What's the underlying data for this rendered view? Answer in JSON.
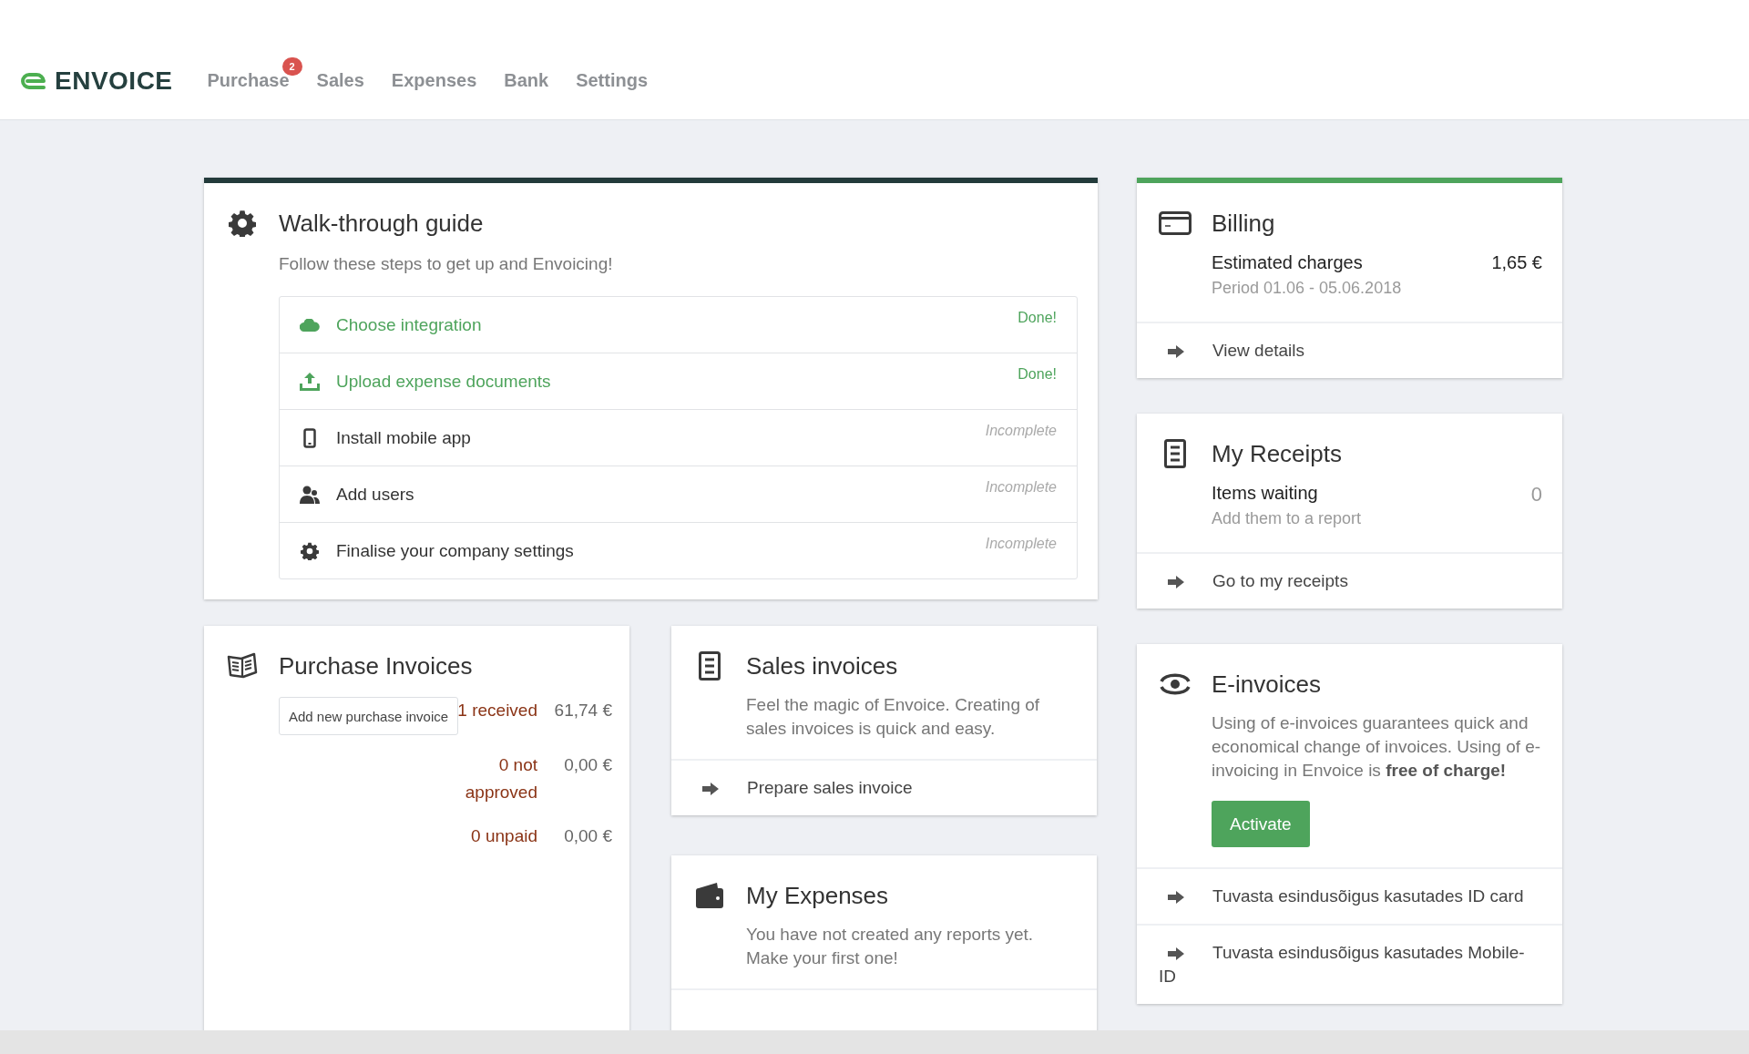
{
  "header": {
    "logo": "ENVOICE",
    "nav": [
      {
        "label": "Purchase",
        "badge": "2"
      },
      {
        "label": "Sales"
      },
      {
        "label": "Expenses"
      },
      {
        "label": "Bank"
      },
      {
        "label": "Settings"
      }
    ]
  },
  "walkthrough": {
    "title": "Walk-through guide",
    "subtitle": "Follow these steps to get up and Envoicing!",
    "steps": [
      {
        "label": "Choose integration",
        "status": "Done!",
        "done": true
      },
      {
        "label": "Upload expense documents",
        "status": "Done!",
        "done": true
      },
      {
        "label": "Install mobile app",
        "status": "Incomplete",
        "done": false
      },
      {
        "label": "Add users",
        "status": "Incomplete",
        "done": false
      },
      {
        "label": "Finalise your company settings",
        "status": "Incomplete",
        "done": false
      }
    ]
  },
  "purchase_invoices": {
    "title": "Purchase Invoices",
    "add_button": "Add new purchase invoice",
    "stats": [
      {
        "label": "1 received",
        "amount": "61,74 €"
      },
      {
        "label": "0 not approved",
        "amount": "0,00 €"
      },
      {
        "label": "0 unpaid",
        "amount": "0,00 €"
      }
    ]
  },
  "sales_invoices": {
    "title": "Sales invoices",
    "description": "Feel the magic of Envoice. Creating of sales invoices is quick and easy.",
    "link": "Prepare sales invoice"
  },
  "my_expenses": {
    "title": "My Expenses",
    "description": "You have not created any reports yet. Make your first one!"
  },
  "billing": {
    "title": "Billing",
    "item": "Estimated charges",
    "amount": "1,65 €",
    "period": "Period 01.06 - 05.06.2018",
    "link": "View details"
  },
  "my_receipts": {
    "title": "My Receipts",
    "item": "Items waiting",
    "count": "0",
    "hint": "Add them to a report",
    "link": "Go to my receipts"
  },
  "e_invoices": {
    "title": "E-invoices",
    "description": "Using of e-invoices guarantees quick and economical change of invoices. Using of e-invoicing in Envoice is **free of charge!**",
    "button": "Activate",
    "links": [
      "Tuvasta esindusõigus kasutades ID card",
      "Tuvasta esindusõigus kasutades Mobile-ID"
    ]
  }
}
